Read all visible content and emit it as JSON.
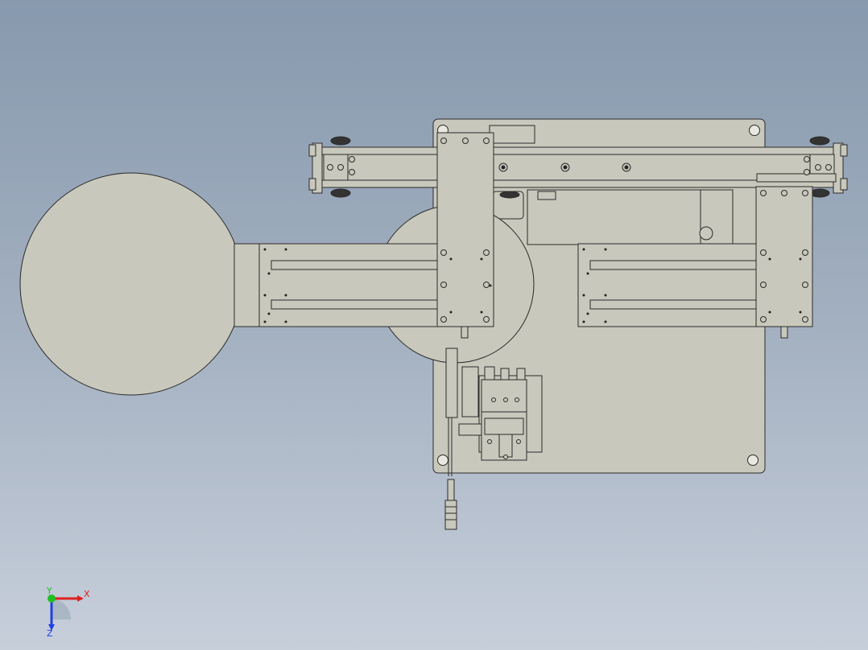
{
  "view": {
    "background_top": "#8799ae",
    "background_bottom": "#c7cfdb",
    "part_fill": "#c9c8bc",
    "part_stroke": "#2b2b2b"
  },
  "triad": {
    "x_label": "X",
    "y_label": "Y",
    "z_label": "Z",
    "x_color": "#e02020",
    "y_color": "#20c020",
    "z_color": "#2040e0"
  }
}
